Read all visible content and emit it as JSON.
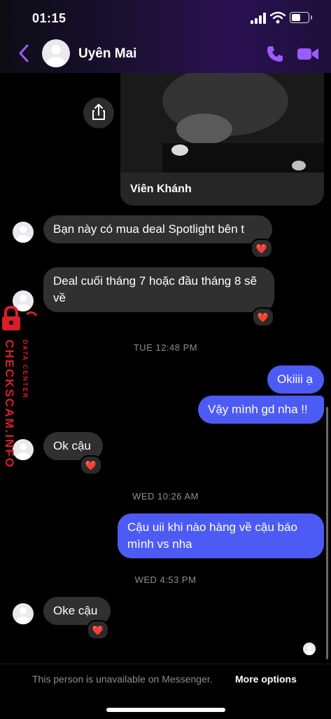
{
  "status_bar": {
    "time": "01:15"
  },
  "header": {
    "contact_name": "Uyên Mai"
  },
  "shared_post": {
    "title": "Viên Khánh"
  },
  "messages": [
    {
      "text": "Bạn này có mua deal Spotlight bên t",
      "reaction": "❤️"
    },
    {
      "text": "Deal cuối tháng  7 hoặc đầu tháng 8 sẽ về",
      "reaction": "❤️"
    },
    {
      "timestamp": "TUE 12:48 PM"
    },
    {
      "text": "Okiiii ạ"
    },
    {
      "text": "Vậy mình gd nha !!"
    },
    {
      "text": "Ok cậu",
      "reaction": "❤️"
    },
    {
      "timestamp": "WED 10:26 AM"
    },
    {
      "text": "Cậu uii khi nào hàng về cậu báo mình vs nha"
    },
    {
      "timestamp": "WED 4:53 PM"
    },
    {
      "text": "Oke cậu",
      "reaction": "❤️"
    }
  ],
  "footer": {
    "notice": "This person is unavailable on Messenger.",
    "link": "More options"
  },
  "watermark": {
    "line1": "DATA CENTER",
    "line2": "CHECKSCAM.INFO"
  },
  "colors": {
    "accent": "#8a3ffc",
    "outgoing": "#4d5bf5",
    "incoming": "#303030"
  }
}
